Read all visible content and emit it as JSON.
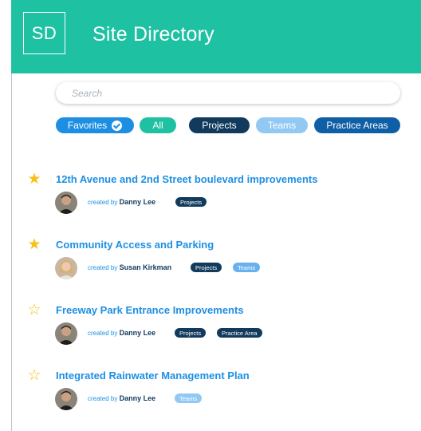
{
  "header": {
    "logo": "SD",
    "title": "Site Directory",
    "color": "#1fc1a3"
  },
  "search": {
    "placeholder": "Search",
    "value": ""
  },
  "filters": {
    "favorites": "Favorites",
    "all": "All",
    "projects": "Projects",
    "teams": "Teams",
    "practice_areas": "Practice Areas"
  },
  "sites": [
    {
      "title": "12th Avenue and 2nd Street boulevard improvements",
      "favorite": true,
      "created_prefix": "created by",
      "author": "Danny Lee",
      "tags": [
        "Projects"
      ]
    },
    {
      "title": "Community Access and Parking",
      "favorite": true,
      "created_prefix": "created by",
      "author": "Susan Kirkman",
      "tags": [
        "Projects",
        "Teams"
      ]
    },
    {
      "title": "Freeway Park Entrance Improvements",
      "favorite": false,
      "created_prefix": "created by",
      "author": "Danny Lee",
      "tags": [
        "Projects",
        "Practice Area"
      ]
    },
    {
      "title": "Integrated Rainwater Management Plan",
      "favorite": false,
      "created_prefix": "created by",
      "author": "Danny Lee",
      "tags": [
        "Teams"
      ]
    }
  ],
  "icons": {
    "star_filled": "star-filled-icon",
    "star_empty": "star-outline-icon",
    "check": "check-circle-icon"
  },
  "colors": {
    "accent": "#1d8fe3",
    "navy": "#113a5c",
    "star": "#f6c21a"
  }
}
